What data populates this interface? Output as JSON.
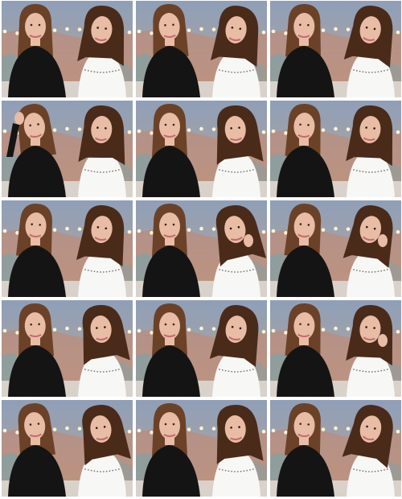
{
  "grid": {
    "rows": 5,
    "columns": 3
  },
  "palette": {
    "sky_top": "#8f9fb8",
    "sky_bottom": "#b4a596",
    "wall_warm": "#c8856a",
    "pattern": "#7fa2a8",
    "bulb": "#fff3d2",
    "sofa": "#d9d2cb",
    "hair_left": "#6b4227",
    "hair_right": "#4a2a19",
    "skin": "#e8bca5",
    "top_left": "#141414",
    "top_right": "#f7f7f5",
    "trim_dots": "#777777",
    "lips": "#c56a6e"
  },
  "frames": [
    {
      "left_tilt": 0,
      "right_tilt": 6,
      "right_hand": false,
      "left_hand": false
    },
    {
      "left_tilt": -3,
      "right_tilt": 8,
      "right_hand": false,
      "left_hand": false
    },
    {
      "left_tilt": 2,
      "right_tilt": 10,
      "right_hand": false,
      "left_hand": false
    },
    {
      "left_tilt": -8,
      "right_tilt": 4,
      "right_hand": false,
      "left_hand": true
    },
    {
      "left_tilt": 0,
      "right_tilt": -4,
      "right_hand": false,
      "left_hand": false
    },
    {
      "left_tilt": 3,
      "right_tilt": 6,
      "right_hand": false,
      "left_hand": false
    },
    {
      "left_tilt": 4,
      "right_tilt": 8,
      "right_hand": false,
      "left_hand": false
    },
    {
      "left_tilt": 0,
      "right_tilt": -10,
      "right_hand": true,
      "left_hand": false
    },
    {
      "left_tilt": 5,
      "right_tilt": 12,
      "right_hand": true,
      "left_hand": false
    },
    {
      "left_tilt": -2,
      "right_tilt": -6,
      "right_hand": false,
      "left_hand": false
    },
    {
      "left_tilt": 0,
      "right_tilt": 10,
      "right_hand": false,
      "left_hand": false
    },
    {
      "left_tilt": 3,
      "right_tilt": 6,
      "right_hand": true,
      "left_hand": false
    },
    {
      "left_tilt": -6,
      "right_tilt": -8,
      "right_hand": false,
      "left_hand": false
    },
    {
      "left_tilt": 0,
      "right_tilt": -4,
      "right_hand": false,
      "left_hand": false
    },
    {
      "left_tilt": 4,
      "right_tilt": 14,
      "right_hand": false,
      "left_hand": false
    }
  ]
}
